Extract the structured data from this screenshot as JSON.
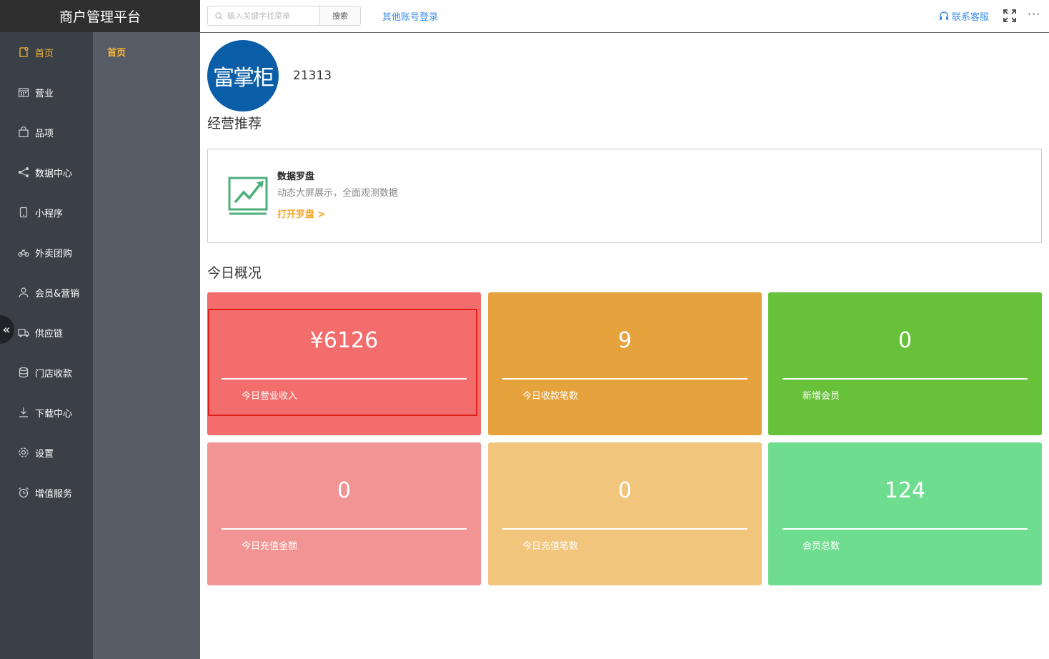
{
  "header": {
    "brand": "商户管理平台",
    "search_placeholder": "输入关键字找菜单",
    "search_button": "搜索",
    "other_login": "其他账号登录",
    "contact": "联系客服",
    "more": "···"
  },
  "sidebar": {
    "items": [
      {
        "label": "首页",
        "icon": "home-icon"
      },
      {
        "label": "营业",
        "icon": "calendar-icon"
      },
      {
        "label": "品项",
        "icon": "bag-icon"
      },
      {
        "label": "数据中心",
        "icon": "share-icon"
      },
      {
        "label": "小程序",
        "icon": "phone-icon"
      },
      {
        "label": "外卖团购",
        "icon": "bike-icon"
      },
      {
        "label": "会员&营销",
        "icon": "user-icon"
      },
      {
        "label": "供应链",
        "icon": "truck-icon"
      },
      {
        "label": "门店收款",
        "icon": "database-icon"
      },
      {
        "label": "下载中心",
        "icon": "download-icon"
      },
      {
        "label": "设置",
        "icon": "gear-icon"
      },
      {
        "label": "增值服务",
        "icon": "alarm-icon"
      }
    ],
    "collapse": "«"
  },
  "subnav": {
    "active": "首页"
  },
  "shop": {
    "logo_text": "富掌柜",
    "id": "21313"
  },
  "recommend": {
    "title": "经营推荐",
    "card_title": "数据罗盘",
    "card_desc": "动态大屏展示，全面观测数据",
    "card_link": "打开罗盘 >"
  },
  "overview": {
    "title": "今日概况",
    "cards": [
      {
        "value": "¥6126",
        "label": "今日营业收入",
        "color": "#f46d6d"
      },
      {
        "value": "9",
        "label": "今日收款笔数",
        "color": "#e6a23c"
      },
      {
        "value": "0",
        "label": "新增会员",
        "color": "#67c23a"
      },
      {
        "value": "0",
        "label": "今日充值金额",
        "color": "#f39494"
      },
      {
        "value": "0",
        "label": "今日充值笔数",
        "color": "#f2c57c"
      },
      {
        "value": "124",
        "label": "会员总数",
        "color": "#6fdd8f"
      }
    ]
  },
  "colors": {
    "accent": "#f5b73b",
    "link": "#3a8ee6",
    "sidebar": "#3b4047",
    "subnav": "#565d66"
  }
}
